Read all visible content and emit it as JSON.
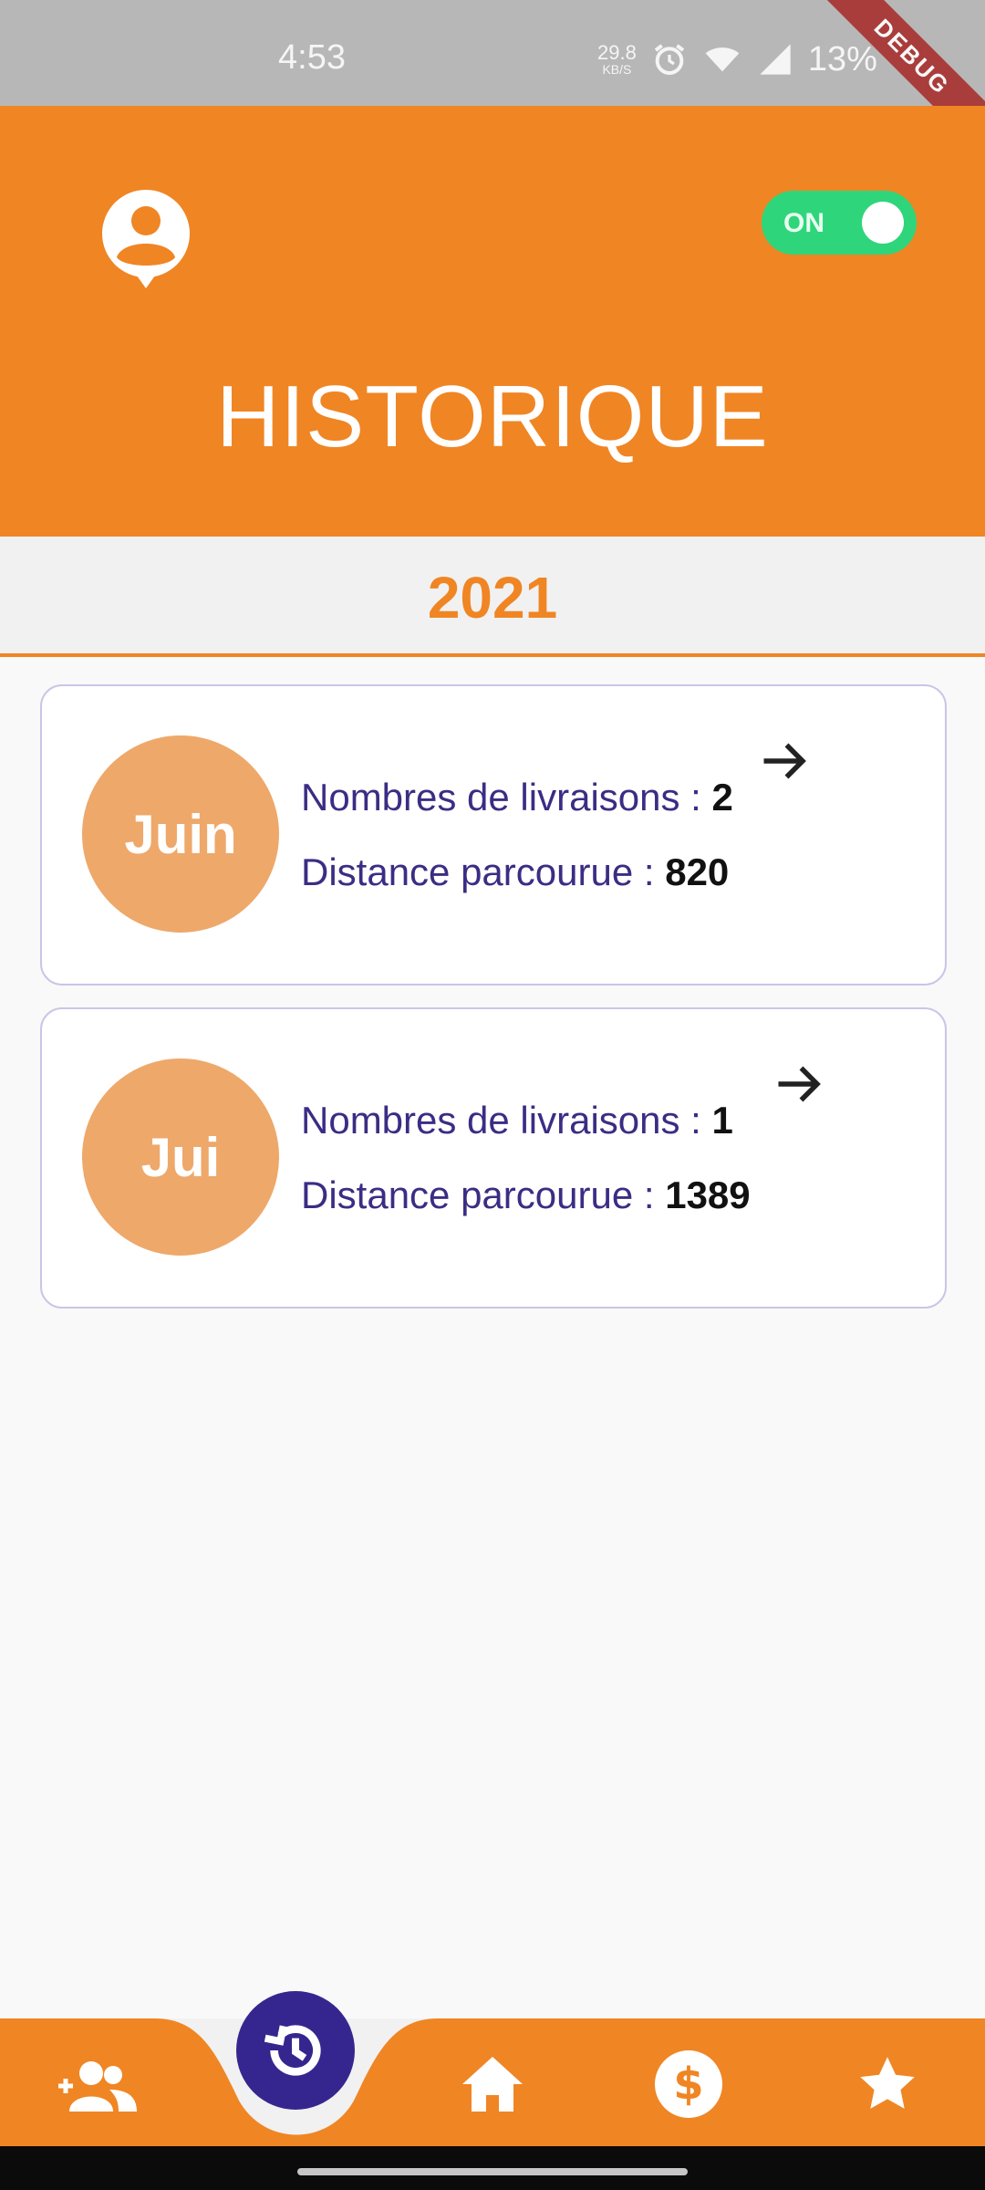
{
  "status_bar": {
    "time": "4:53",
    "net_speed_value": "29.8",
    "net_speed_unit": "KB/S",
    "battery": "13%"
  },
  "debug_banner": "DEBUG",
  "header": {
    "title": "HISTORIQUE",
    "toggle_label": "ON",
    "toggle_on": true
  },
  "year": "2021",
  "cards": [
    {
      "month": "Juin",
      "deliveries_label": "Nombres de livraisons : ",
      "deliveries_value": "2",
      "distance_label": "Distance parcourue : ",
      "distance_value": "820"
    },
    {
      "month": "Jui",
      "deliveries_label": "Nombres de livraisons : ",
      "deliveries_value": "1",
      "distance_label": "Distance parcourue : ",
      "distance_value": "1389"
    }
  ],
  "bottom_nav": {
    "items": [
      "contacts-icon",
      "history-icon",
      "home-icon",
      "dollar-icon",
      "star-icon"
    ],
    "active": "history-icon"
  },
  "colors": {
    "primary": "#f08524",
    "accent": "#35268f",
    "toggle_on": "#2fd57a",
    "month_circle": "#eea86a",
    "card_text": "#3b2d84"
  }
}
